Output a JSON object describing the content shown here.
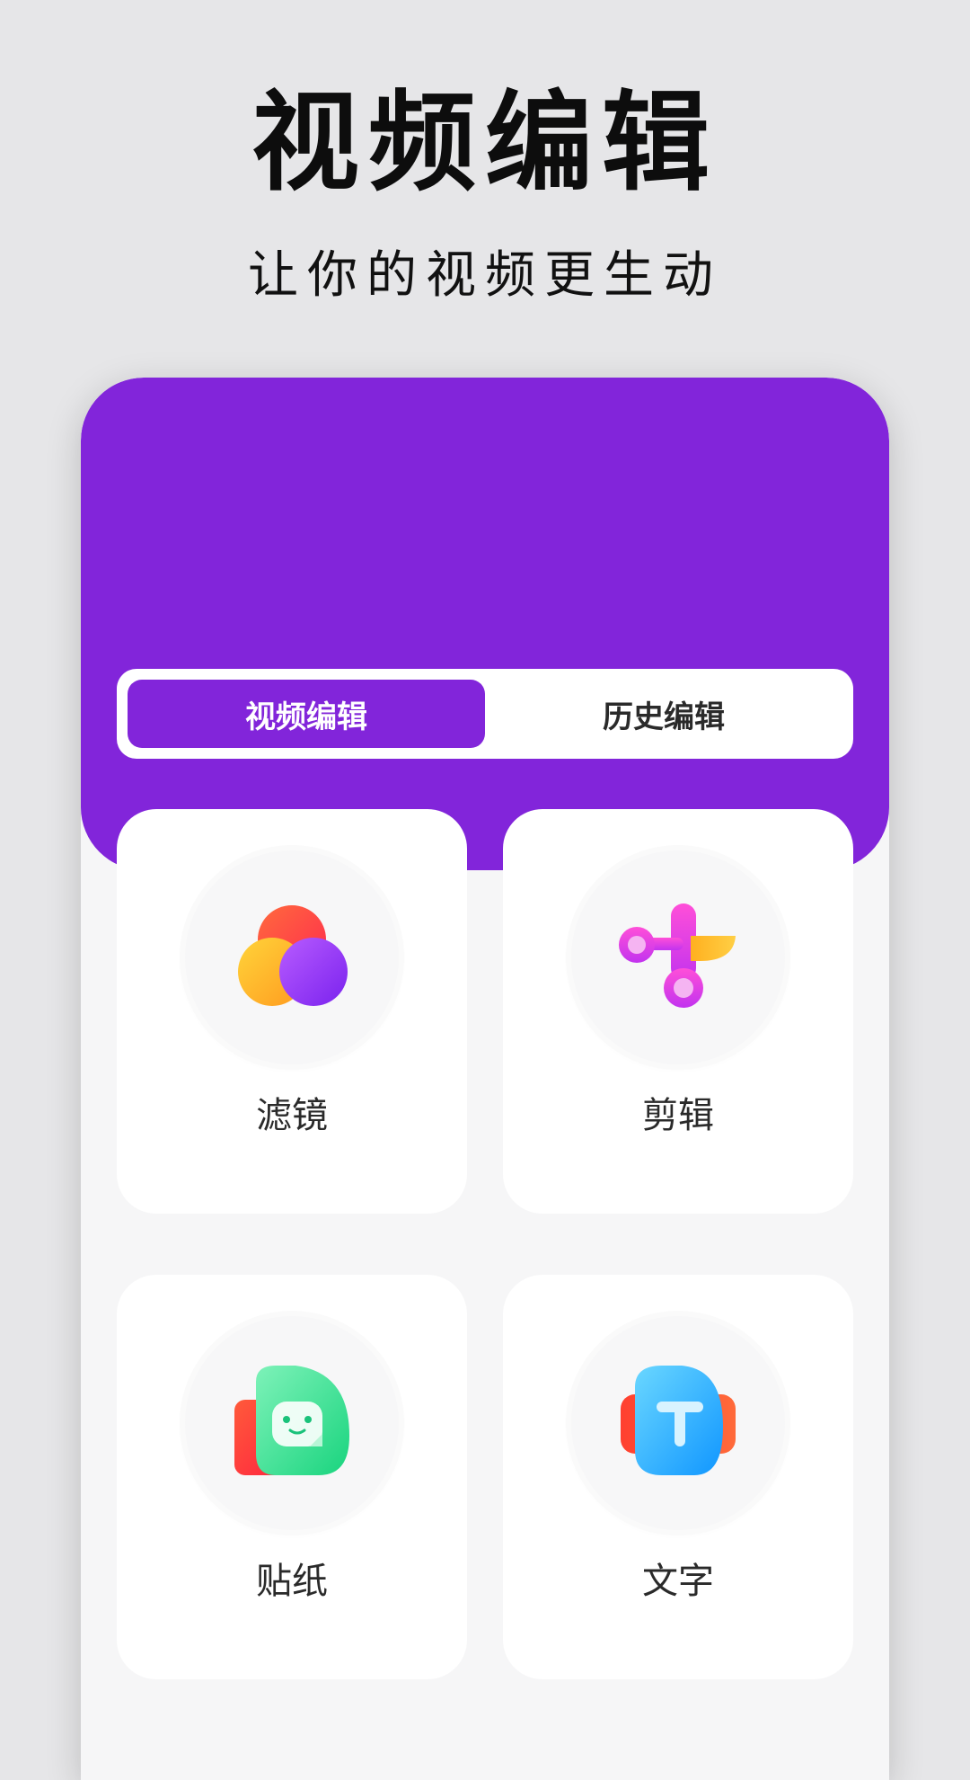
{
  "promo": {
    "title": "视频编辑",
    "subtitle": "让你的视频更生动"
  },
  "tabs": [
    {
      "label": "视频编辑",
      "active": true
    },
    {
      "label": "历史编辑",
      "active": false
    }
  ],
  "features": [
    {
      "label": "滤镜",
      "icon": "filter-icon"
    },
    {
      "label": "剪辑",
      "icon": "scissors-icon"
    },
    {
      "label": "贴纸",
      "icon": "sticker-icon"
    },
    {
      "label": "文字",
      "icon": "text-icon"
    }
  ],
  "colors": {
    "accent": "#8225da",
    "background": "#e6e6e8",
    "card": "#ffffff"
  }
}
